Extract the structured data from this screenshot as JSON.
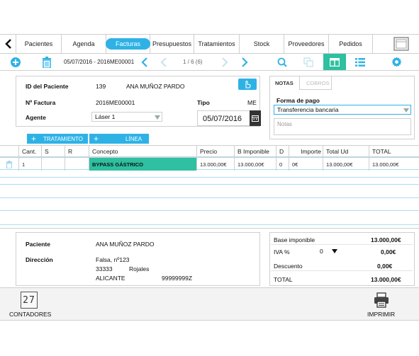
{
  "nav": {
    "back_icon": "chevron-left-icon",
    "tabs": [
      {
        "label": "Pacientes"
      },
      {
        "label": "Agenda"
      },
      {
        "label": "Facturas",
        "active": true
      },
      {
        "label": "Presupuestos"
      },
      {
        "label": "Tratamientos"
      },
      {
        "label": "Stock"
      },
      {
        "label": "Proveedores"
      },
      {
        "label": "Pedidos"
      }
    ],
    "menu_icon": "window-icon"
  },
  "toolbar": {
    "add_icon": "plus-circle-icon",
    "delete_icon": "trash-icon",
    "range_text": "05/07/2016 - 2016ME00001",
    "pager_text": "1 / 6 (6)",
    "search_icon": "search-icon",
    "copy_icon": "copy-icon",
    "layout_icon": "layout-icon",
    "list_icon": "list-icon",
    "settings_icon": "gear-icon"
  },
  "invoice": {
    "patient_id_label": "ID del Paciente",
    "patient_id": "139",
    "patient_name": "ANA MUÑOZ PARDO",
    "invoice_no_label": "Nº Factura",
    "invoice_no": "2016ME00001",
    "type_label": "Tipo",
    "type_value": "ME",
    "agent_label": "Agente",
    "agent_value": "Láser 1",
    "date_value": "05/07/2016"
  },
  "notes": {
    "tab_notas": "NOTAS",
    "tab_cobros": "COBROS",
    "payment_label": "Forma de pago",
    "payment_value": "Transferencia bancaria",
    "notes_placeholder": "Notas"
  },
  "buttons": {
    "treatment": "TRATAMIENTO",
    "line": "LÍNEA"
  },
  "table": {
    "headers": [
      "Cant.",
      "S",
      "R",
      "Concepto",
      "Precio",
      "B Imponible",
      "D",
      "Importe",
      "Total Ud",
      "TOTAL"
    ],
    "rows": [
      {
        "cant": "1",
        "s": "",
        "r": "",
        "concepto": "BYPASS GÁSTRICO",
        "precio": "13.000,00€",
        "base": "13.000,00€",
        "d": "0",
        "importe": "0€",
        "total_ud": "13.000,00€",
        "total": "13.000,00€"
      }
    ]
  },
  "patient_footer": {
    "patient_label": "Paciente",
    "patient_value": "ANA MUÑOZ PARDO",
    "address_label": "Dirección",
    "street": "Falsa, nº123",
    "postal": "33333",
    "city": "Rojales",
    "province": "ALICANTE",
    "phone": "99999999Z"
  },
  "totals": {
    "base_label": "Base imponible",
    "base_value": "13.000,00€",
    "iva_label": "IVA %",
    "iva_select": "0",
    "iva_value": "0,00€",
    "discount_label": "Descuento",
    "discount_value": "0,00€",
    "total_label": "TOTAL",
    "total_value": "13.000,00€"
  },
  "bottom": {
    "counters_label": "CONTADORES",
    "counters_glyph": "27",
    "print_label": "IMPRIMIR"
  },
  "colors": {
    "accent_blue": "#2eb2e6",
    "accent_green": "#2ec0a0",
    "border": "#cfcfcf"
  }
}
